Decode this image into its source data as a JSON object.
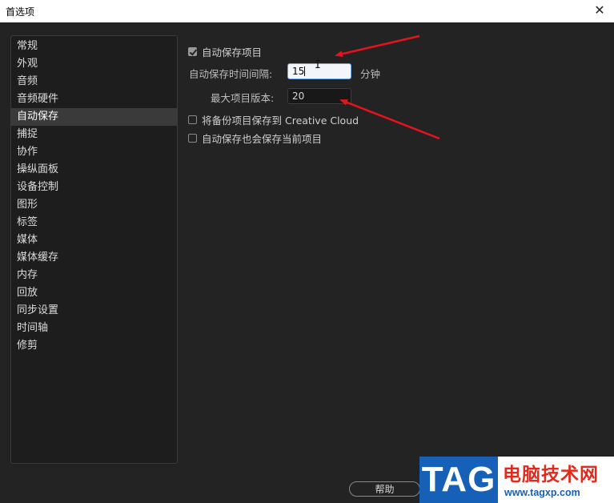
{
  "window": {
    "title": "首选项",
    "close_glyph": "✕"
  },
  "sidebar": {
    "items": [
      {
        "label": "常规"
      },
      {
        "label": "外观"
      },
      {
        "label": "音频"
      },
      {
        "label": "音频硬件"
      },
      {
        "label": "自动保存",
        "active": true
      },
      {
        "label": "捕捉"
      },
      {
        "label": "协作"
      },
      {
        "label": "操纵面板"
      },
      {
        "label": "设备控制"
      },
      {
        "label": "图形"
      },
      {
        "label": "标签"
      },
      {
        "label": "媒体"
      },
      {
        "label": "媒体缓存"
      },
      {
        "label": "内存"
      },
      {
        "label": "回放"
      },
      {
        "label": "同步设置"
      },
      {
        "label": "时间轴"
      },
      {
        "label": "修剪"
      }
    ]
  },
  "autosave": {
    "autosave_projects": {
      "label": "自动保存项目",
      "checked": true
    },
    "interval": {
      "label": "自动保存时间间隔:",
      "value": "15",
      "unit": "分钟"
    },
    "max_versions": {
      "label": "最大项目版本:",
      "value": "20"
    },
    "backup_cloud": {
      "label": "将备份项目保存到 Creative Cloud",
      "checked": false
    },
    "save_current": {
      "label": "自动保存也会保存当前项目",
      "checked": false
    }
  },
  "footer": {
    "help_label": "帮助"
  },
  "watermark": {
    "tag": "TAG",
    "name": "电脑技术网",
    "url": "www.tagxp.com"
  },
  "colors": {
    "background": "#232323",
    "arrow": "#e5131b",
    "accent_focus": "#6aa9ee"
  }
}
